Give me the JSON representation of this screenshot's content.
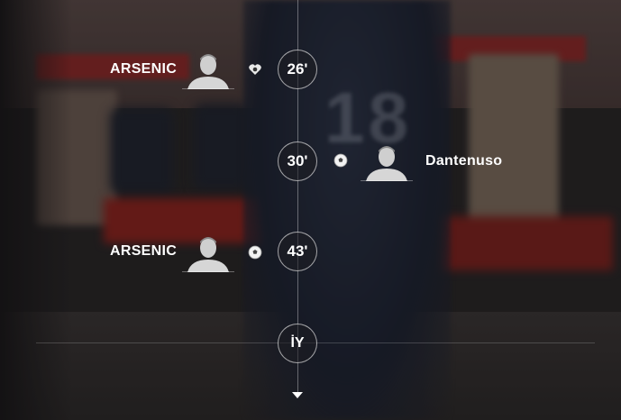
{
  "events": [
    {
      "minute": "26'",
      "side": "left",
      "player": "ARSENIC",
      "icon": "assist-icon"
    },
    {
      "minute": "30'",
      "side": "right",
      "player": "Dantenuso",
      "icon": "soccer-ball-icon"
    },
    {
      "minute": "43'",
      "side": "left",
      "player": "ARSENIC",
      "icon": "soccer-ball-icon"
    }
  ],
  "period_marker": "İY",
  "colors": {
    "accent": "#ffffff",
    "shirt_blue": "#1f2433"
  }
}
